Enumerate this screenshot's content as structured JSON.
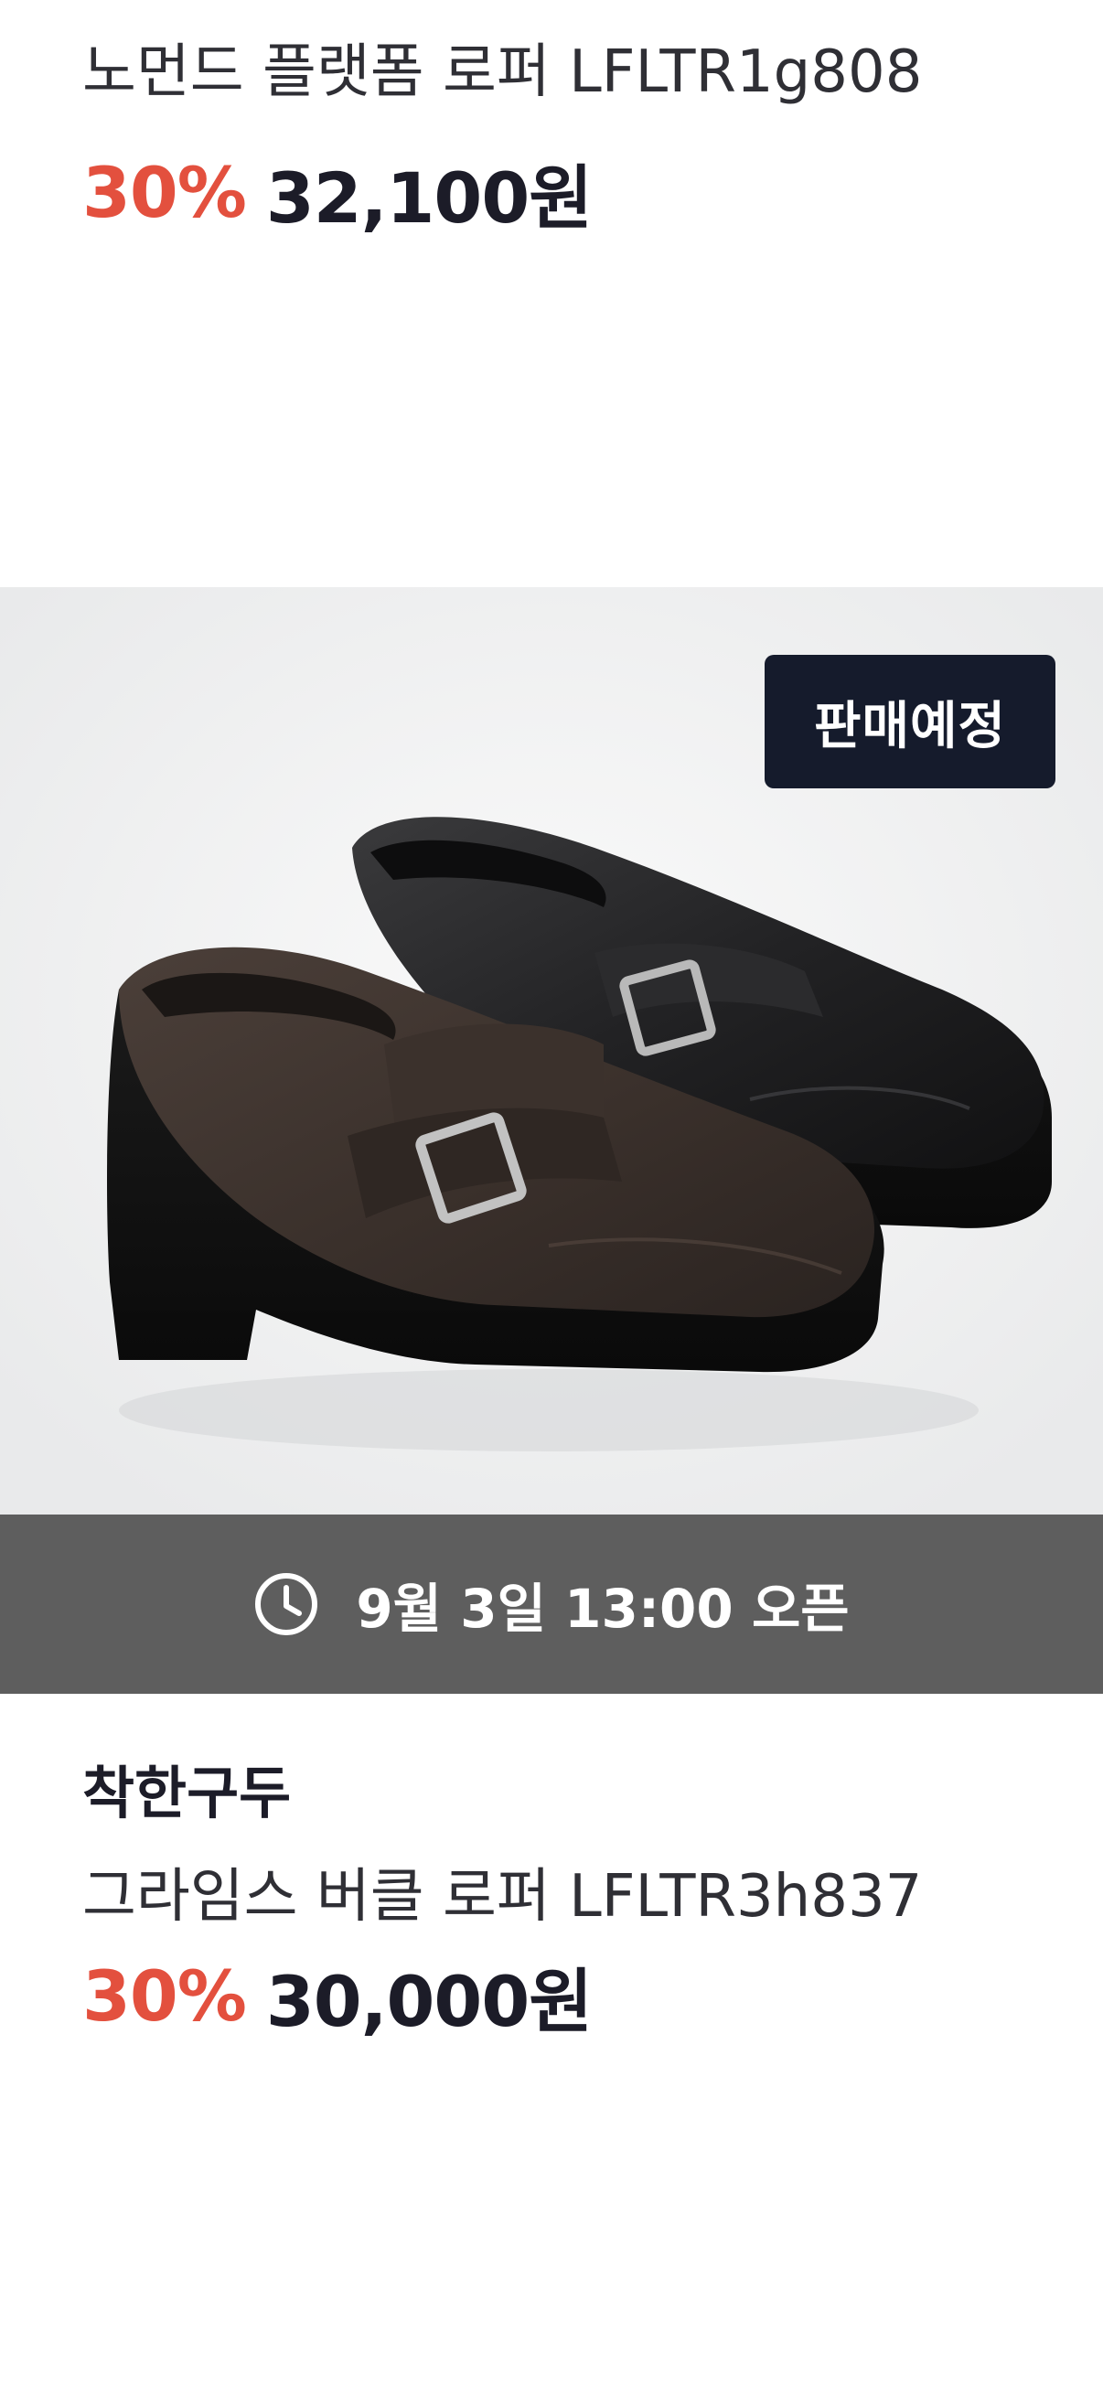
{
  "top_product": {
    "name": "노먼드 플랫폼 로퍼 LFLTR1g808",
    "discount": "30%",
    "price": "32,100원"
  },
  "product": {
    "badge": "판매예정",
    "image_icon": "loafer-shoes-image",
    "open_time": "9월 3일 13:00 오픈",
    "open_icon": "clock-icon",
    "brand": "착한구두",
    "name": "그라임스 버클 로퍼 LFLTR3h837",
    "discount": "30%",
    "price": "30,000원"
  },
  "colors": {
    "discount": "#e3503e",
    "price": "#1c1c28",
    "badge_bg": "#151b2c",
    "open_bar_bg": "#5e5e5e"
  }
}
